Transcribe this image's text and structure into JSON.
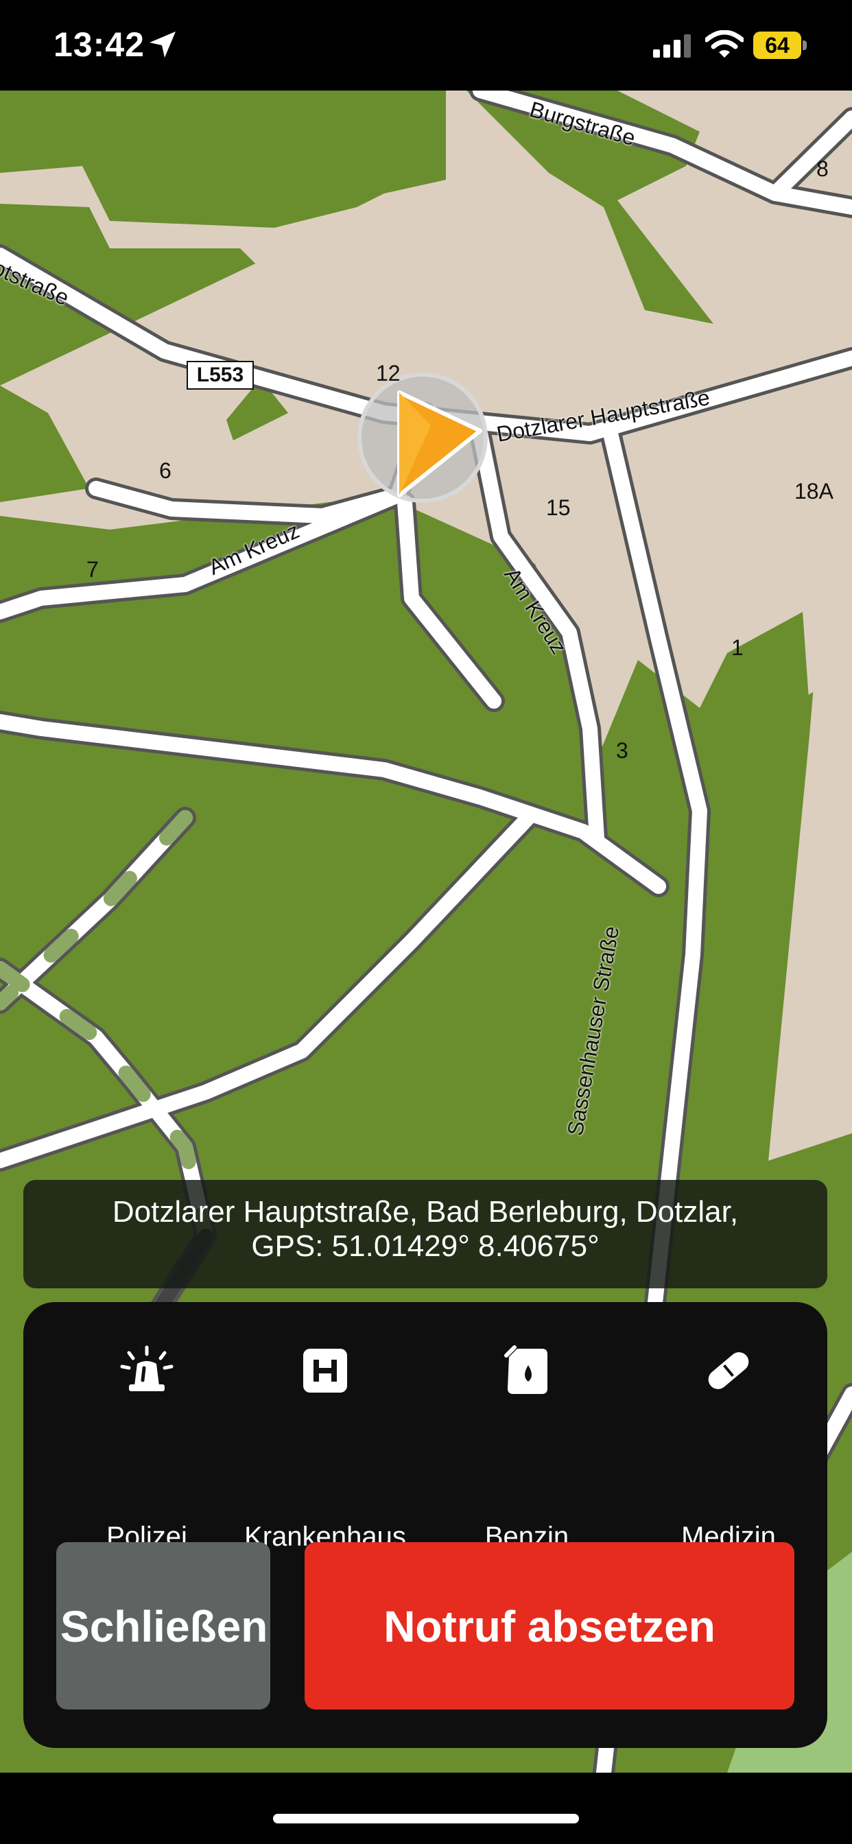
{
  "status": {
    "time": "13:42",
    "battery": "64"
  },
  "map": {
    "streets": {
      "burgstrasse": "Burgstraße",
      "hauptstrasse_left": "Hauptstraße",
      "dotzlarer": "Dotzlarer Hauptstraße",
      "am_kreuz_left": "Am Kreuz",
      "am_kreuz_right": "Am Kreuz",
      "sassenhauser": "Sassenhauser Straße"
    },
    "road_badge": "L553",
    "house_numbers": [
      "8",
      "12",
      "6",
      "15",
      "18A",
      "7",
      "1",
      "3"
    ],
    "colors": {
      "forest": "#6a8d2e",
      "built": "#dccfbf",
      "road": "#ffffff",
      "position": "#f6a21a"
    }
  },
  "address": {
    "line1": "Dotzlarer Hauptstraße, Bad Berleburg, Dotzlar,",
    "line2": "GPS: 51.01429° 8.40675°"
  },
  "services": [
    {
      "label": "Polizei",
      "icon": "siren-icon"
    },
    {
      "label": "Krankenhaus",
      "icon": "hospital-icon"
    },
    {
      "label": "Benzin",
      "icon": "fuel-can-icon"
    },
    {
      "label": "Medizin",
      "icon": "pill-icon"
    }
  ],
  "buttons": {
    "close": "Schließen",
    "emergency": "Notruf absetzen"
  }
}
